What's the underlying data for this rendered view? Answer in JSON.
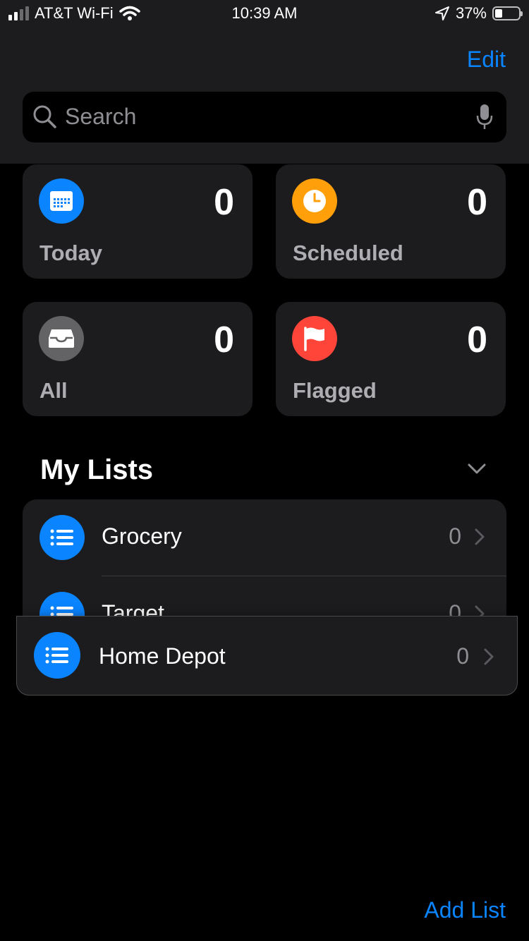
{
  "status_bar": {
    "carrier": "AT&T Wi-Fi",
    "time": "10:39 AM",
    "battery": "37%",
    "battery_level": 0.37
  },
  "header": {
    "edit_label": "Edit"
  },
  "search": {
    "placeholder": "Search"
  },
  "smart_lists": [
    {
      "label": "Today",
      "count": "0",
      "color": "#0a84ff",
      "icon": "calendar-icon"
    },
    {
      "label": "Scheduled",
      "count": "0",
      "color": "#ff9f0a",
      "icon": "clock-icon"
    },
    {
      "label": "All",
      "count": "0",
      "color": "#636366",
      "icon": "tray-icon"
    },
    {
      "label": "Flagged",
      "count": "0",
      "color": "#ff453a",
      "icon": "flag-icon"
    }
  ],
  "my_lists": {
    "title": "My Lists",
    "items": [
      {
        "name": "Grocery",
        "count": "0",
        "icon": "list-bullet-icon"
      },
      {
        "name": "Target",
        "count": "0",
        "icon": "list-bullet-icon"
      }
    ],
    "dragged_item": {
      "name": "Home Depot",
      "count": "0",
      "icon": "list-bullet-icon"
    }
  },
  "footer": {
    "add_list_label": "Add List"
  },
  "colors": {
    "accent": "#0a84ff",
    "background": "#000000",
    "card": "#1c1c1e"
  }
}
